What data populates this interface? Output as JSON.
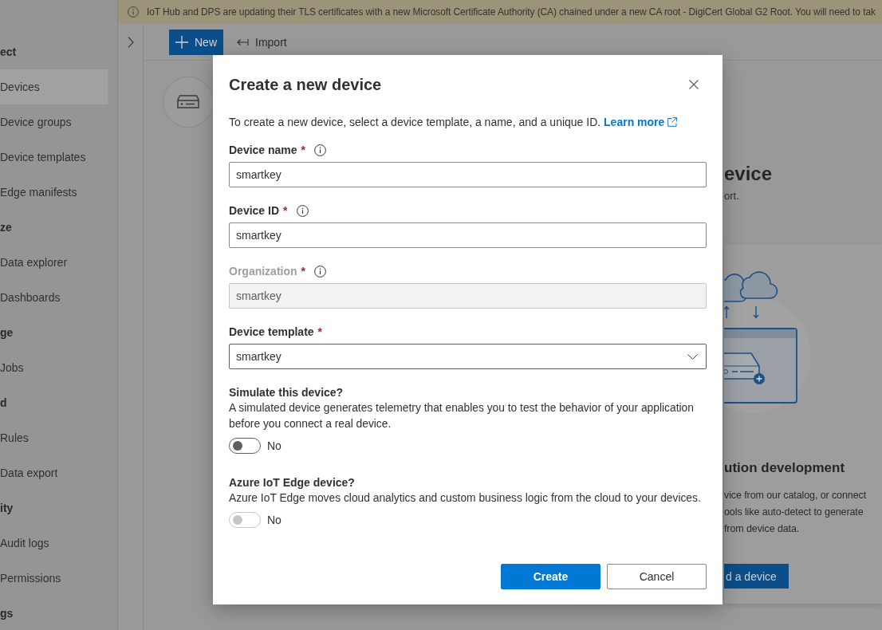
{
  "banner": {
    "text": "IoT Hub and DPS are updating their TLS certificates with a new Microsoft Certificate Authority (CA) chained under a new CA root - DigiCert Global G2 Root. You will need to tak"
  },
  "sidebar": {
    "sections": [
      {
        "title": "ect",
        "items": [
          {
            "label": "Devices",
            "selected": true
          },
          {
            "label": "Device groups",
            "selected": false
          },
          {
            "label": "Device templates",
            "selected": false
          },
          {
            "label": "Edge manifests",
            "selected": false
          }
        ]
      },
      {
        "title": "ze",
        "items": [
          {
            "label": "Data explorer",
            "selected": false
          },
          {
            "label": "Dashboards",
            "selected": false
          }
        ]
      },
      {
        "title": "ge",
        "items": [
          {
            "label": "Jobs",
            "selected": false
          }
        ]
      },
      {
        "title": "d",
        "items": [
          {
            "label": "Rules",
            "selected": false
          },
          {
            "label": "Data export",
            "selected": false
          }
        ]
      },
      {
        "title": "ity",
        "items": [
          {
            "label": "Audit logs",
            "selected": false
          },
          {
            "label": "Permissions",
            "selected": false
          }
        ]
      },
      {
        "title": "gs"
      }
    ]
  },
  "toolbar": {
    "buttons": [
      {
        "label": "New",
        "kind": "new"
      },
      {
        "label": "Import",
        "kind": "import"
      }
    ]
  },
  "devices_page": {
    "heading": "evice",
    "subheading": "ort.",
    "card": {
      "heading": "ution development",
      "description_lines": [
        "vice from our catalog, or connect",
        "ools like auto-detect to generate",
        "from device data."
      ],
      "button": "d a device"
    }
  },
  "dialog": {
    "title": "Create a new device",
    "intro": "To create a new device, select a device template, a name, and a unique ID.",
    "link": "Learn more",
    "fields": [
      {
        "kind": "text",
        "label": "Device name",
        "required_mark": "*",
        "info": true,
        "value": "smartkey",
        "disabled": false
      },
      {
        "kind": "text",
        "label": "Device ID",
        "required_mark": "*",
        "info": true,
        "value": "smartkey",
        "disabled": false
      },
      {
        "kind": "text",
        "label": "Organization",
        "required_mark": "*",
        "info": true,
        "value": "smartkey",
        "disabled": true
      },
      {
        "kind": "dropdown",
        "label": "Device template",
        "required_mark": "*",
        "info": false,
        "value": "smartkey",
        "disabled": false
      }
    ],
    "toggles": [
      {
        "title": "Simulate this device?",
        "description": "A simulated device generates telemetry that enables you to test the behavior of your application before you connect a real device.",
        "on": false,
        "disabled": false,
        "state_label": "No"
      },
      {
        "title": "Azure IoT Edge device?",
        "description": "Azure IoT Edge moves cloud analytics and custom business logic from the cloud to your devices.",
        "on": false,
        "disabled": true,
        "state_label": "No"
      }
    ],
    "buttons": [
      {
        "label": "Create",
        "kind": "primary"
      },
      {
        "label": "Cancel",
        "kind": "secondary"
      }
    ]
  }
}
